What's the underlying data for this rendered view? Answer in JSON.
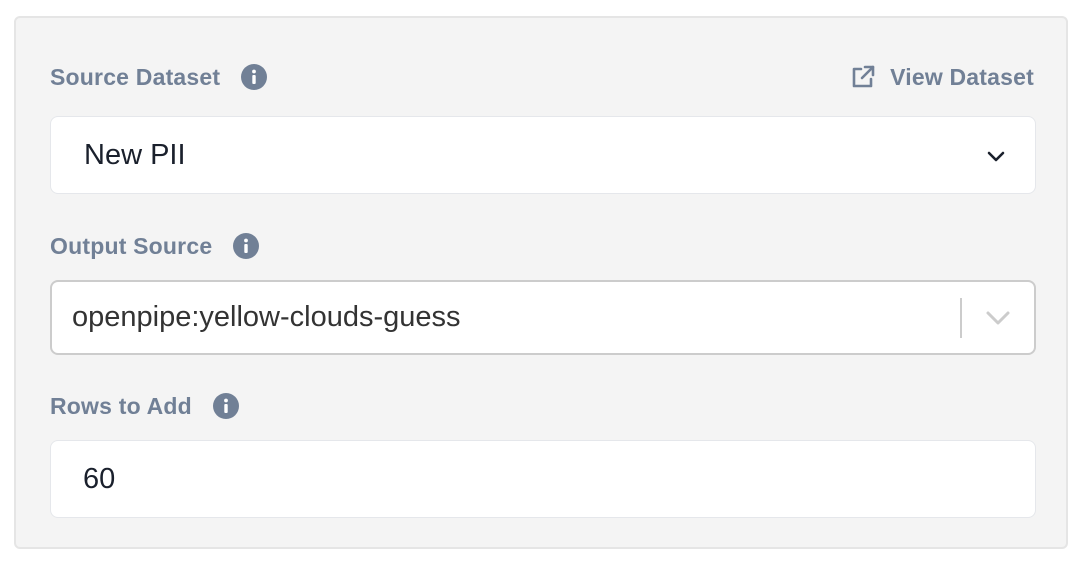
{
  "source_dataset": {
    "label": "Source Dataset",
    "info_icon": "info-circle-icon",
    "view_link_label": "View Dataset",
    "view_link_icon": "external-link-icon",
    "selected_value": "New PII",
    "dropdown_icon": "chevron-down-icon"
  },
  "output_source": {
    "label": "Output Source",
    "info_icon": "info-circle-icon",
    "selected_value": "openpipe:yellow-clouds-guess",
    "dropdown_icon": "chevron-down-icon"
  },
  "rows_to_add": {
    "label": "Rows to Add",
    "info_icon": "info-circle-icon",
    "value": "60"
  },
  "colors": {
    "label": "#718096",
    "panel_bg": "#f4f4f4",
    "field_bg": "#ffffff",
    "combo_border": "#cccccc"
  }
}
